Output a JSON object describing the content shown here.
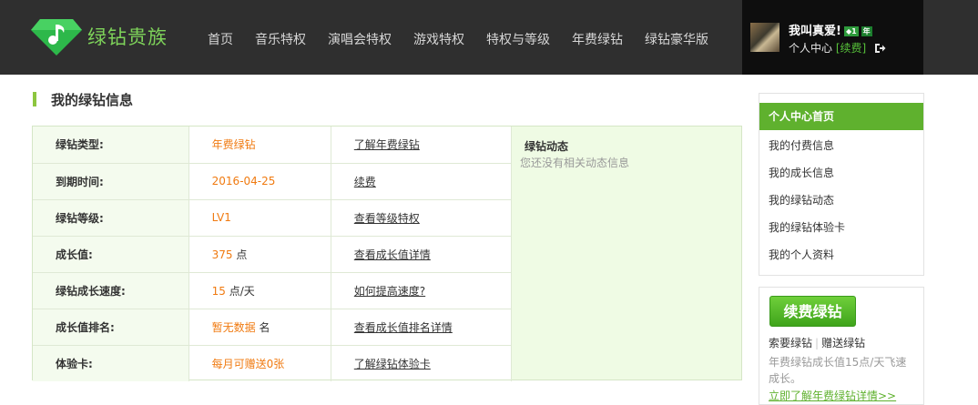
{
  "header": {
    "logo_text": "绿钻贵族",
    "nav": [
      "首页",
      "音乐特权",
      "演唱会特权",
      "游戏特权",
      "特权与等级",
      "年费绿钻",
      "绿钻豪华版"
    ],
    "user": {
      "name": "我叫真爱!",
      "badge_level": "1",
      "badge_year": "年",
      "center_link": "个人中心",
      "renew_link": "[续费]"
    }
  },
  "main": {
    "title": "我的绿钻信息",
    "rows": [
      {
        "label": "绿钻类型:",
        "value": "年费绿钻",
        "unit": "",
        "link": "了解年费绿钻"
      },
      {
        "label": "到期时间:",
        "value": "2016-04-25",
        "unit": "",
        "link": "续费"
      },
      {
        "label": "绿钻等级:",
        "value": "LV1",
        "unit": "",
        "link": "查看等级特权"
      },
      {
        "label": "成长值:",
        "value": "375",
        "unit": " 点",
        "link": "查看成长值详情"
      },
      {
        "label": "绿钻成长速度:",
        "value": "15",
        "unit": " 点/天",
        "link": "如何提高速度?"
      },
      {
        "label": "成长值排名:",
        "value": "暂无数据",
        "unit": " 名",
        "link": "查看成长值排名详情"
      },
      {
        "label": "体验卡:",
        "value": "每月可赠送0张",
        "unit": "",
        "link": "了解绿钻体验卡"
      }
    ],
    "dynamics": {
      "title": "绿钻动态",
      "empty": "您还没有相关动态信息"
    }
  },
  "sidebar": {
    "menu_head": "个人中心首页",
    "menu_items": [
      "我的付费信息",
      "我的成长信息",
      "我的绿钻动态",
      "我的绿钻体验卡",
      "我的个人资料"
    ],
    "promo": {
      "button": "续费绿钻",
      "link_request": "索要绿钻",
      "link_gift": "赠送绿钻",
      "desc": "年费绿钻成长值15点/天飞速成长。",
      "more": "立即了解年费绿钻详情>>"
    }
  },
  "colors": {
    "header_bg": "#2f2f2f",
    "accent_green": "#5fb12e",
    "value_orange": "#f07a10",
    "panel_green": "#effbe4"
  }
}
